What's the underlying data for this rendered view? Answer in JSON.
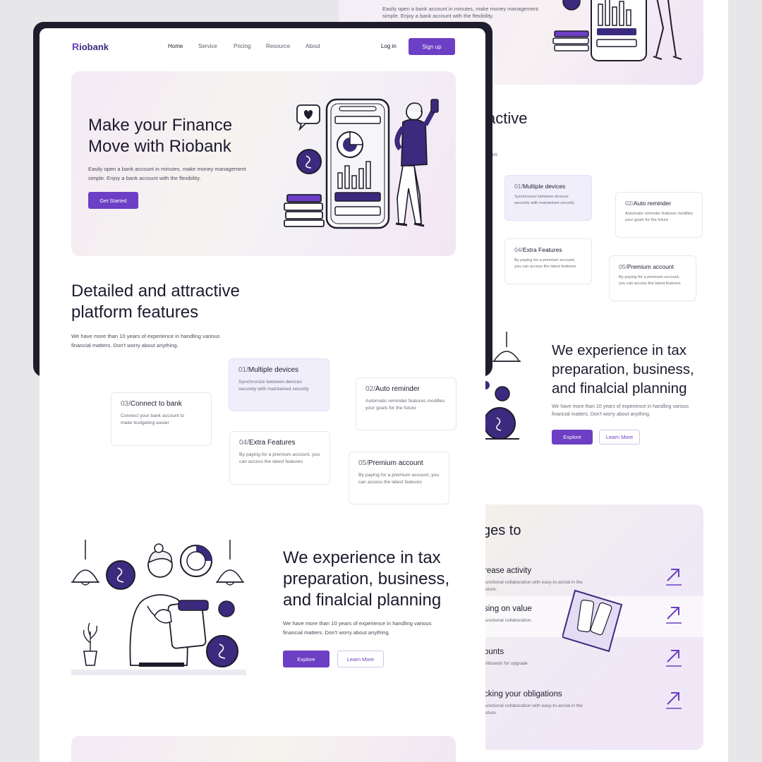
{
  "back": {
    "hero_desc": "Easily open a bank account in minutes, make money management simple. Enjoy a bank account with the flexibility.",
    "features_title_fragment": "active",
    "features_sub_fragment": "rious",
    "cards": [
      {
        "num": "01/",
        "title": "Multiple devices",
        "desc": "Synchronize between devices securely with maintained security"
      },
      {
        "num": "02/",
        "title": "Auto reminder",
        "desc": "Automatic reminder features modifies your goals for the future"
      },
      {
        "num": "04/",
        "title": "Extra Features",
        "desc": "By paying for a premium account, you can access the latest features"
      },
      {
        "num": "05/",
        "title": "Premium account",
        "desc": "By paying for a premium account, you can access the latest features"
      }
    ],
    "tax_title": "We experience in tax preparation, business, and finalcial planning",
    "tax_desc": "We have more than 10 years of experience in handling various financial matters. Don't worry about anything.",
    "explore_label": "Explore",
    "learn_more_label": "Learn More",
    "panel": {
      "heading_fragment": "ges to",
      "rows": [
        {
          "title": "rease activity",
          "desc": "functional collaboration with easy-to-ancial in the future."
        },
        {
          "title": "sing on value",
          "desc": "functional collaboration."
        },
        {
          "title": "ounts",
          "desc": "shboards for upgrade"
        },
        {
          "title": "cking your obligations",
          "desc": "functional collaboration with easy-to-ancial in the future."
        }
      ]
    }
  },
  "front": {
    "logo": "iobank",
    "logo_initial": "R",
    "nav": [
      "Home",
      "Service",
      "Pricing",
      "Resource",
      "About"
    ],
    "login_label": "Log in",
    "signup_label": "Sign up",
    "hero": {
      "title": "Make your Finance Move with Riobank",
      "desc": "Easily open a bank account in minutes, make money management simple. Enjoy a bank account with the flexibility.",
      "cta": "Get Started"
    },
    "features": {
      "title": "Detailed and attractive platform features",
      "desc": "We have more than 10 years of experience in handling various financial matters. Don't worry about anything.",
      "cards": [
        {
          "num": "01/",
          "title": "Multiple devices",
          "desc": "Synchronize between devices securely with maintained security"
        },
        {
          "num": "02/",
          "title": "Auto reminder",
          "desc": "Automatic reminder features modifies your goals for the future"
        },
        {
          "num": "03/",
          "title": "Connect to bank",
          "desc": "Connect your bank account to make budgeting easier"
        },
        {
          "num": "04/",
          "title": "Extra Features",
          "desc": "By paying for a premium account, you can access the latest features"
        },
        {
          "num": "05/",
          "title": "Premium account",
          "desc": "By paying for a premium account, you can access the latest features"
        }
      ]
    },
    "tax": {
      "title": "We experience in tax preparation, business, and finalcial planning",
      "desc": "We have more than 10 years of experience in handling various financial matters. Don't worry about anything.",
      "explore_label": "Explore",
      "learn_more_label": "Learn More"
    }
  },
  "colors": {
    "accent": "#6c3fc4",
    "dark": "#1e1d2c",
    "text": "#1c1b2e"
  }
}
